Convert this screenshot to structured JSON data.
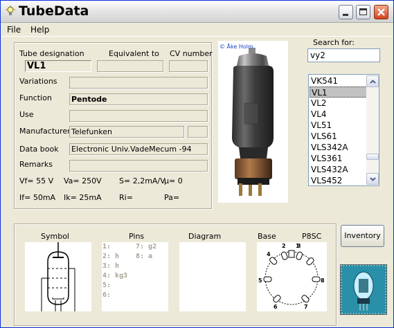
{
  "window": {
    "title": "TubeData"
  },
  "menu": {
    "file": "File",
    "help": "Help"
  },
  "tube": {
    "designation_label": "Tube designation",
    "equivalent_label": "Equivalent to",
    "cv_label": "CV number",
    "designation": "VL1",
    "equivalent": "",
    "cv": "",
    "variations_label": "Variations",
    "variations": "",
    "function_label": "Function",
    "function": "Pentode",
    "use_label": "Use",
    "use": "",
    "manufacturer_label": "Manufacturer",
    "manufacturer": "Telefunken",
    "manufacturer_extra": "",
    "databook_label": "Data book",
    "databook": "Electronic Univ.VadeMecum -94",
    "remarks_label": "Remarks",
    "remarks": ""
  },
  "params": {
    "vf": "Vf= 55 V",
    "va": "Va=  250V",
    "s": "S= 2,2mA/V",
    "mu": "µ=    0",
    "if": "If= 50mA",
    "ik": "Ik=   25mA",
    "ri": "Ri=",
    "pa": "Pa="
  },
  "photo": {
    "copyright": "© Åke Holm"
  },
  "search": {
    "label": "Search for:",
    "value": "vy2",
    "results": [
      "VK541",
      "VL1",
      "VL2",
      "VL4",
      "VL51",
      "VLS61",
      "VLS342A",
      "VLS361",
      "VLS432A",
      "VLS452"
    ],
    "selected_index": 1
  },
  "bottom": {
    "symbol_label": "Symbol",
    "pins_label": "Pins",
    "diagram_label": "Diagram",
    "base_label": "Base",
    "base_type": "P8SC",
    "pins_col1": [
      "1:",
      "2: h",
      "3: h",
      "4: kg3",
      "5:",
      "6:"
    ],
    "pins_col2": [
      "7: g2",
      "8: a"
    ],
    "base_pins": [
      "1",
      "2",
      "3",
      "4",
      "5",
      "6",
      "7",
      "8"
    ]
  },
  "inventory": {
    "label": "Inventory"
  },
  "colors": {
    "title_bar": "#e6e6e6",
    "close_button": "#d6411c",
    "selection": "#c2c2c2",
    "window_bg": "#ece9d8"
  }
}
